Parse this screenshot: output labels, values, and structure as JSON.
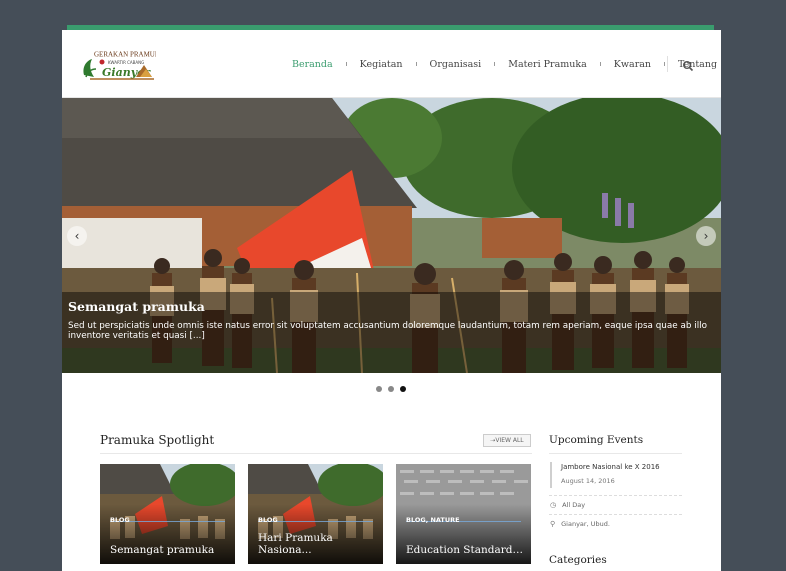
{
  "nav": {
    "items": [
      "Beranda",
      "Kegiatan",
      "Organisasi",
      "Materi Pramuka",
      "Kwaran",
      "Tentang"
    ],
    "active": "Beranda"
  },
  "logo": {
    "line1": "GERAKAN PRAMUKA",
    "line2": "KWARTIR CABANG",
    "line3": "Gianyar"
  },
  "slider": {
    "title": "Semangat pramuka",
    "text": "Sed ut perspiciatis unde omnis iste natus error sit voluptatem accusantium doloremque laudantium, totam rem aperiam, eaque ipsa quae ab illo inventore veritatis et quasi [...]",
    "prev_icon": "chevron-left-icon",
    "next_icon": "chevron-right-icon",
    "dots": 3,
    "active_dot": 3
  },
  "spotlight": {
    "title": "Pramuka Spotlight",
    "view_all": "⇢VIEW ALL",
    "cards": [
      {
        "category": "BLOG",
        "title": "Semangat pramuka"
      },
      {
        "category": "BLOG",
        "title": "Hari Pramuka Nasiona..."
      },
      {
        "category": "BLOG, NATURE",
        "title": "Education Standard i..."
      }
    ]
  },
  "events": {
    "title": "Upcoming Events",
    "name": "Jambore Nasional ke X 2016",
    "date": "August 14, 2016",
    "time": "All Day",
    "location": "Gianyar, Ubud."
  },
  "categories": {
    "title": "Categories"
  },
  "colors": {
    "accent": "#3a9c6e",
    "background": "#454e58"
  }
}
